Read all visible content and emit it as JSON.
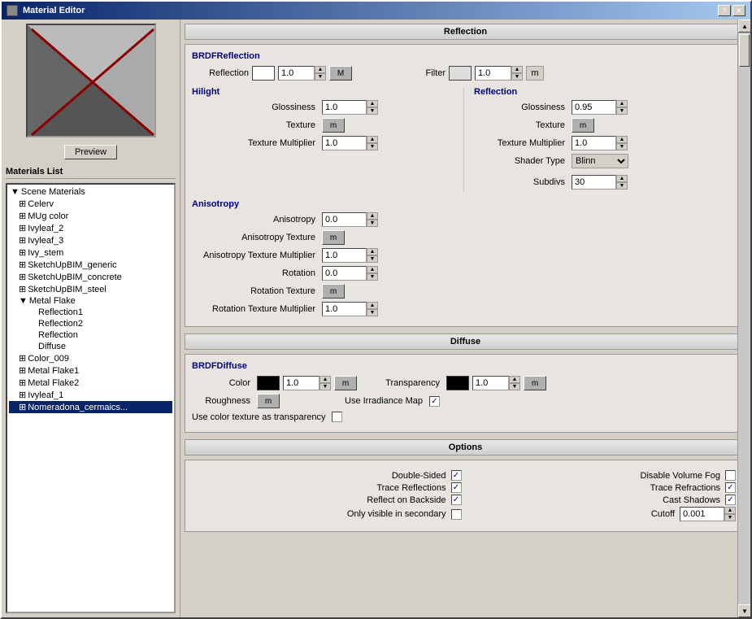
{
  "window": {
    "title": "Material Editor",
    "help_btn": "?",
    "close_btn": "✕"
  },
  "preview": {
    "btn_label": "Preview"
  },
  "materials_list": {
    "label": "Materials List",
    "tree": [
      {
        "id": "scene_materials",
        "label": "Scene Materials",
        "level": 0,
        "expand": true,
        "icon": "▼"
      },
      {
        "id": "celery",
        "label": "Celerv",
        "level": 1,
        "icon": "□"
      },
      {
        "id": "mug_color",
        "label": "MUg color",
        "level": 1,
        "icon": "□"
      },
      {
        "id": "ivyleaf_2",
        "label": "Ivyleaf_2",
        "level": 1,
        "icon": "□"
      },
      {
        "id": "ivyleaf_3",
        "label": "Ivyleaf_3",
        "level": 1,
        "icon": "□"
      },
      {
        "id": "ivy_stem",
        "label": "Ivy_stem",
        "level": 1,
        "icon": "□"
      },
      {
        "id": "sketchupbim_generic",
        "label": "SketchUpBIM_generic",
        "level": 1,
        "icon": "□"
      },
      {
        "id": "sketchupbim_concrete",
        "label": "SketchUpBIM_concrete",
        "level": 1,
        "icon": "□"
      },
      {
        "id": "sketchupbim_steel",
        "label": "SketchUpBIM_steel",
        "level": 1,
        "icon": "□"
      },
      {
        "id": "metal_flake",
        "label": "Metal Flake",
        "level": 1,
        "expand": true,
        "icon": "▼"
      },
      {
        "id": "reflection1",
        "label": "Reflection1",
        "level": 2
      },
      {
        "id": "reflection2",
        "label": "Reflection2",
        "level": 2
      },
      {
        "id": "reflection",
        "label": "Reflection",
        "level": 2
      },
      {
        "id": "diffuse",
        "label": "Diffuse",
        "level": 2
      },
      {
        "id": "color_009",
        "label": "Color_009",
        "level": 1,
        "icon": "□"
      },
      {
        "id": "metal_flake1",
        "label": "Metal Flake1",
        "level": 1,
        "icon": "□"
      },
      {
        "id": "metal_flake2",
        "label": "Metal Flake2",
        "level": 1,
        "icon": "□"
      },
      {
        "id": "ivyleaf_1",
        "label": "Ivyleaf_1",
        "level": 1,
        "icon": "□"
      },
      {
        "id": "nomeradona_ceramics",
        "label": "Nomeradona_cermaics...",
        "level": 1,
        "selected": true,
        "icon": "□"
      }
    ]
  },
  "reflection_section": {
    "header": "Reflection",
    "brdf_title": "BRDFReflection",
    "reflection_label": "Reflection",
    "reflection_value": "1.0",
    "filter_label": "Filter",
    "filter_value": "1.0",
    "filter_unit": "m",
    "hilight": {
      "title": "Hilight",
      "glossiness_label": "Glossiness",
      "glossiness_value": "1.0",
      "texture_label": "Texture",
      "texture_btn": "m",
      "tex_multiplier_label": "Texture Multiplier",
      "tex_multiplier_value": "1.0"
    },
    "reflection_sub": {
      "title": "Reflection",
      "glossiness_label": "Glossiness",
      "glossiness_value": "0.95",
      "texture_label": "Texture",
      "texture_btn": "m",
      "tex_multiplier_label": "Texture Multiplier",
      "tex_multiplier_value": "1.0",
      "shader_type_label": "Shader Type",
      "shader_type_value": "Blinn",
      "subdivs_label": "Subdivs",
      "subdivs_value": "30"
    },
    "anisotropy": {
      "title": "Anisotropy",
      "anisotropy_label": "Anisotropy",
      "anisotropy_value": "0.0",
      "texture_label": "Anisotropy Texture",
      "texture_btn": "m",
      "tex_mult_label": "Anisotropy Texture Multiplier",
      "tex_mult_value": "1.0",
      "rotation_label": "Rotation",
      "rotation_value": "0.0",
      "rot_tex_label": "Rotation Texture",
      "rot_tex_btn": "m",
      "rot_tex_mult_label": "Rotation Texture Multiplier",
      "rot_tex_mult_value": "1.0"
    }
  },
  "diffuse_section": {
    "header": "Diffuse",
    "brdf_title": "BRDFDiffuse",
    "color_label": "Color",
    "color_value": "1.0",
    "color_btn": "m",
    "transparency_label": "Transparency",
    "transparency_value": "1.0",
    "transparency_btn": "m",
    "roughness_label": "Roughness",
    "roughness_btn": "m",
    "irradiance_label": "Use Irradiance Map",
    "use_color_tex_label": "Use color texture as transparency"
  },
  "options_section": {
    "header": "Options",
    "double_sided_label": "Double-Sided",
    "trace_reflections_label": "Trace Reflections",
    "reflect_backside_label": "Reflect on Backside",
    "only_visible_label": "Only visible in secondary",
    "disable_vol_fog_label": "Disable Volume Fog",
    "trace_refractions_label": "Trace Refractions",
    "cast_shadows_label": "Cast Shadows",
    "cutoff_label": "Cutoff",
    "cutoff_value": "0.001"
  }
}
